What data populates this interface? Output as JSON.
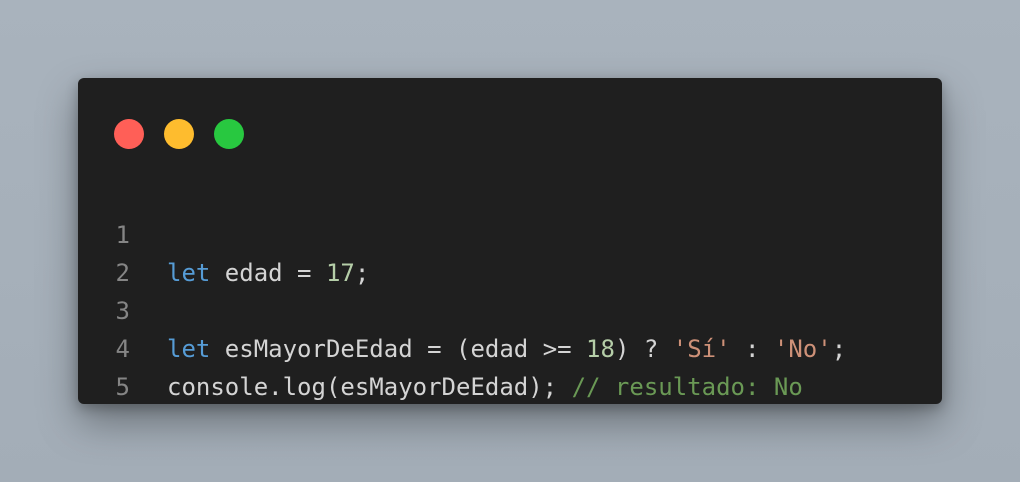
{
  "window": {
    "controls": [
      "close",
      "minimize",
      "maximize"
    ],
    "colors": {
      "background": "#1f1f1f",
      "close": "#ff5f57",
      "minimize": "#febc2e",
      "maximize": "#28c840"
    }
  },
  "code": {
    "colors": {
      "keyword": "#569cd6",
      "number": "#b5cea8",
      "string": "#ce9178",
      "comment": "#6a9955",
      "plain": "#d4d4d4",
      "line_number": "#858585"
    },
    "lines": [
      {
        "number": "1",
        "tokens": [
          {
            "type": "keyword",
            "text": "let"
          },
          {
            "type": "plain",
            "text": " edad = "
          },
          {
            "type": "number",
            "text": "17"
          },
          {
            "type": "plain",
            "text": ";"
          }
        ]
      },
      {
        "number": "2",
        "tokens": []
      },
      {
        "number": "3",
        "tokens": [
          {
            "type": "keyword",
            "text": "let"
          },
          {
            "type": "plain",
            "text": " esMayorDeEdad = (edad >= "
          },
          {
            "type": "number",
            "text": "18"
          },
          {
            "type": "plain",
            "text": ") ? "
          },
          {
            "type": "string",
            "text": "'Sí'"
          },
          {
            "type": "plain",
            "text": " : "
          },
          {
            "type": "string",
            "text": "'No'"
          },
          {
            "type": "plain",
            "text": ";"
          }
        ]
      },
      {
        "number": "4",
        "tokens": [
          {
            "type": "plain",
            "text": "console.log(esMayorDeEdad); "
          },
          {
            "type": "comment",
            "text": "// resultado: No"
          }
        ]
      },
      {
        "number": "5",
        "tokens": []
      }
    ]
  }
}
